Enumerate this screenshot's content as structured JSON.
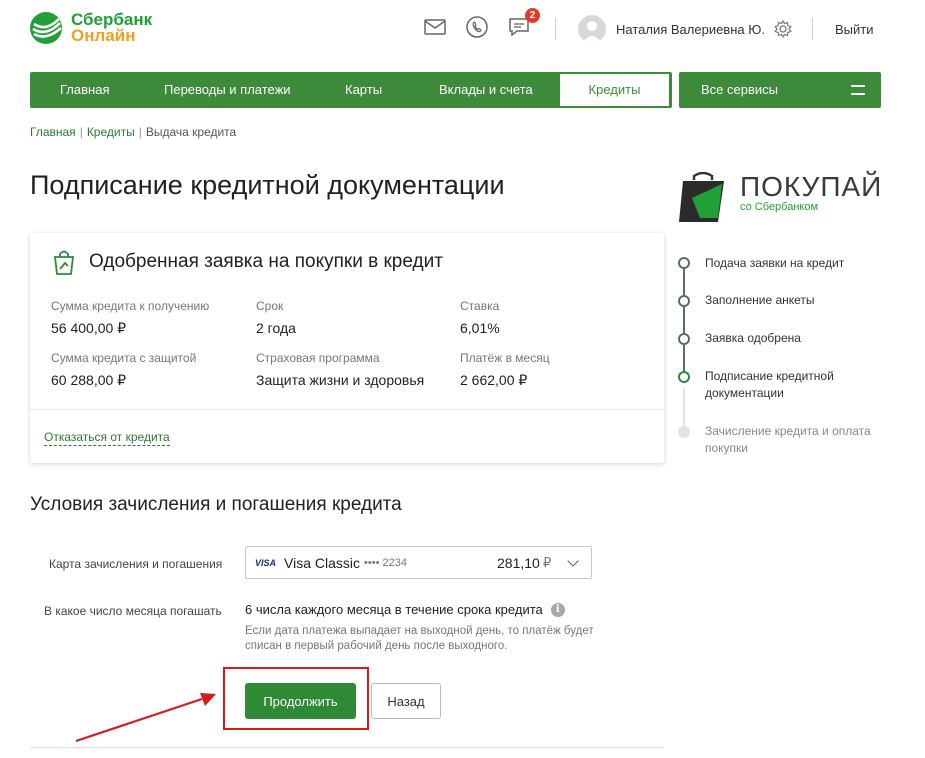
{
  "header": {
    "logo_line1": "Сбербанк",
    "logo_line2": "Онлайн",
    "notifications_count": "2",
    "user_name": "Наталия Валериевна Ю.",
    "logout": "Выйти"
  },
  "nav": {
    "items": [
      "Главная",
      "Переводы и платежи",
      "Карты",
      "Вклады и счета",
      "Кредиты"
    ],
    "active": "Кредиты",
    "all_services": "Все сервисы"
  },
  "breadcrumb": [
    "Главная",
    "Кредиты",
    "Выдача кредита"
  ],
  "page_title": "Подписание кредитной документации",
  "card": {
    "title": "Одобренная заявка на покупки в кредит",
    "fields": [
      {
        "label": "Сумма кредита к получению",
        "value": "56 400,00 ₽"
      },
      {
        "label": "Срок",
        "value": "2 года"
      },
      {
        "label": "Ставка",
        "value": "6,01%"
      },
      {
        "label": "Сумма кредита с защитой",
        "value": "60 288,00 ₽"
      },
      {
        "label": "Страховая программа",
        "value": "Защита жизни и здоровья"
      },
      {
        "label": "Платёж в месяц",
        "value": "2 662,00 ₽"
      }
    ],
    "refuse_link": "Отказаться от кредита"
  },
  "conditions": {
    "title": "Условия зачисления и погашения кредита",
    "card_label": "Карта зачисления и погашения",
    "card_brand": "VISA",
    "card_name": "Visa Classic",
    "card_number": "•••• 2234",
    "card_amount": "281,10",
    "card_currency": "₽",
    "payday_label": "В какое число месяца погашать",
    "payday_value": "6 числа каждого месяца в течение срока кредита",
    "payday_note": "Если дата платежа выпадает на выходной день, то платёж будет списан в первый рабочий день после выходного.",
    "continue_button": "Продолжить",
    "back_button": "Назад"
  },
  "pokupay": {
    "title": "ПОКУПАЙ",
    "subtitle": "со Сбербанком"
  },
  "steps": [
    {
      "label": "Подача заявки на кредит",
      "state": "done"
    },
    {
      "label": "Заполнение анкеты",
      "state": "done"
    },
    {
      "label": "Заявка одобрена",
      "state": "done"
    },
    {
      "label": "Подписание кредитной документации",
      "state": "active"
    },
    {
      "label": "Зачисление кредита и оплата покупки",
      "state": "pending"
    }
  ],
  "colors": {
    "brand_green": "#3e8a3b",
    "button_green": "#2f8a36",
    "highlight_red": "#d71a1a",
    "logo_orange": "#f0a020"
  }
}
